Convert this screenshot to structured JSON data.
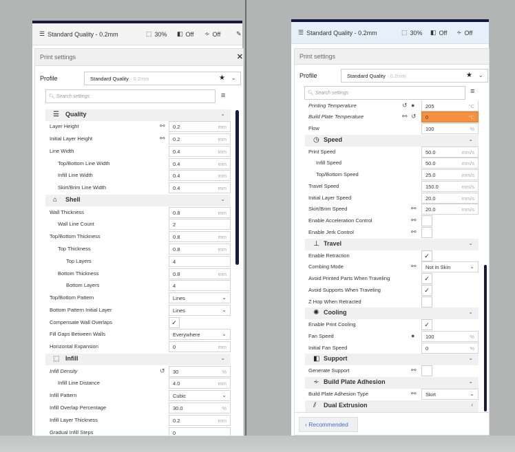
{
  "header": {
    "profile": "Standard Quality - 0.2mm",
    "infill": "30%",
    "support": "Off",
    "adhesion": "Off"
  },
  "print_settings": {
    "title": "Print settings",
    "profile_label": "Profile",
    "profile_name": "Standard Quality",
    "profile_sub": "- 0.2mm",
    "search_placeholder": "Search settings"
  },
  "recommended_label": "Recommended",
  "colors": {
    "accent_bar": "#141a3f",
    "warning_field": "#f5913e",
    "link_blue": "#3f6fd1"
  },
  "panels": [
    {
      "rows": [
        {
          "type": "header",
          "label": "Quality",
          "icon": "quality-icon"
        },
        {
          "label": "Layer Height",
          "value": "0.2",
          "unit": "mm",
          "icons": [
            "link"
          ]
        },
        {
          "label": "Initial Layer Height",
          "value": "0.2",
          "unit": "mm",
          "icons": [
            "link"
          ]
        },
        {
          "label": "Line Width",
          "value": "0.4",
          "unit": "mm"
        },
        {
          "label": "Top/Bottom Line Width",
          "value": "0.4",
          "unit": "mm",
          "indent": 1
        },
        {
          "label": "Infill Line Width",
          "value": "0.4",
          "unit": "mm",
          "indent": 1
        },
        {
          "label": "Skirt/Brim Line Width",
          "value": "0.4",
          "unit": "mm",
          "indent": 1
        },
        {
          "type": "header",
          "label": "Shell",
          "icon": "shell-icon"
        },
        {
          "label": "Wall Thickness",
          "value": "0.8",
          "unit": "mm"
        },
        {
          "label": "Wall Line Count",
          "value": "2",
          "indent": 1
        },
        {
          "label": "Top/Bottom Thickness",
          "value": "0.8",
          "unit": "mm"
        },
        {
          "label": "Top Thickness",
          "value": "0.8",
          "unit": "mm",
          "indent": 1
        },
        {
          "label": "Top Layers",
          "value": "4",
          "indent": 2
        },
        {
          "label": "Bottom Thickness",
          "value": "0.8",
          "unit": "mm",
          "indent": 1
        },
        {
          "label": "Bottom Layers",
          "value": "4",
          "indent": 2
        },
        {
          "label": "Top/Bottom Pattern",
          "type": "select",
          "value": "Lines"
        },
        {
          "label": "Bottom Pattern Initial Layer",
          "type": "select",
          "value": "Lines"
        },
        {
          "label": "Compensate Wall Overlaps",
          "type": "checkbox",
          "checked": true
        },
        {
          "label": "Fill Gaps Between Walls",
          "type": "select",
          "value": "Everywhere"
        },
        {
          "label": "Horizontal Expansion",
          "value": "0",
          "unit": "mm"
        },
        {
          "type": "header",
          "label": "Infill",
          "icon": "infill-icon"
        },
        {
          "label": "Infill Density",
          "value": "30",
          "unit": "%",
          "italic": true,
          "icons": [
            "reset"
          ]
        },
        {
          "label": "Infill Line Distance",
          "value": "4.0",
          "unit": "mm",
          "indent": 1
        },
        {
          "label": "Infill Pattern",
          "type": "select",
          "value": "Cubic"
        },
        {
          "label": "Infill Overlap Percentage",
          "value": "30.0",
          "unit": "%"
        },
        {
          "label": "Infill Layer Thickness",
          "value": "0.2",
          "unit": "mm"
        },
        {
          "label": "Gradual Infill Steps",
          "value": "0"
        }
      ]
    },
    {
      "rows": [
        {
          "label": "Printing Temperature",
          "value": "205",
          "unit": "°C",
          "italic": true,
          "icons": [
            "reset",
            "function"
          ]
        },
        {
          "label": "Build Plate Temperature",
          "value": "0",
          "unit": "°C",
          "italic": true,
          "warning": true,
          "icons": [
            "link",
            "reset"
          ]
        },
        {
          "label": "Flow",
          "value": "100",
          "unit": "%"
        },
        {
          "type": "header",
          "label": "Speed",
          "icon": "speed-icon"
        },
        {
          "label": "Print Speed",
          "value": "50.0",
          "unit": "mm/s"
        },
        {
          "label": "Infill Speed",
          "value": "50.0",
          "unit": "mm/s",
          "indent": 1
        },
        {
          "label": "Top/Bottom Speed",
          "value": "25.0",
          "unit": "mm/s",
          "indent": 1
        },
        {
          "label": "Travel Speed",
          "value": "150.0",
          "unit": "mm/s"
        },
        {
          "label": "Initial Layer Speed",
          "value": "20.0",
          "unit": "mm/s"
        },
        {
          "label": "Skirt/Brim Speed",
          "value": "20.0",
          "unit": "mm/s",
          "icons": [
            "link"
          ]
        },
        {
          "label": "Enable Acceleration Control",
          "type": "checkbox",
          "checked": false,
          "icons": [
            "link"
          ]
        },
        {
          "label": "Enable Jerk Control",
          "type": "checkbox",
          "checked": false,
          "icons": [
            "link"
          ]
        },
        {
          "type": "header",
          "label": "Travel",
          "icon": "travel-icon"
        },
        {
          "label": "Enable Retraction",
          "type": "checkbox",
          "checked": true
        },
        {
          "label": "Combing Mode",
          "type": "select",
          "value": "Not in Skin",
          "icons": [
            "link"
          ]
        },
        {
          "label": "Avoid Printed Parts When Traveling",
          "type": "checkbox",
          "checked": true
        },
        {
          "label": "Avoid Supports When Traveling",
          "type": "checkbox",
          "checked": true
        },
        {
          "label": "Z Hop When Retracted",
          "type": "checkbox",
          "checked": false
        },
        {
          "type": "header",
          "label": "Cooling",
          "icon": "cooling-icon"
        },
        {
          "label": "Enable Print Cooling",
          "type": "checkbox",
          "checked": true
        },
        {
          "label": "Fan Speed",
          "value": "100",
          "unit": "%",
          "icons": [
            "function"
          ]
        },
        {
          "label": "Initial Fan Speed",
          "value": "0",
          "unit": "%"
        },
        {
          "type": "header",
          "label": "Support",
          "icon": "support-icon"
        },
        {
          "label": "Generate Support",
          "type": "checkbox",
          "checked": false,
          "icons": [
            "link"
          ]
        },
        {
          "type": "header",
          "label": "Build Plate Adhesion",
          "icon": "adhesion-icon"
        },
        {
          "label": "Build Plate Adhesion Type",
          "type": "select",
          "value": "Skirt",
          "icons": [
            "link"
          ]
        },
        {
          "type": "header",
          "label": "Dual Extrusion",
          "icon": "dual-extrusion-icon",
          "collapsed": true
        }
      ]
    }
  ]
}
